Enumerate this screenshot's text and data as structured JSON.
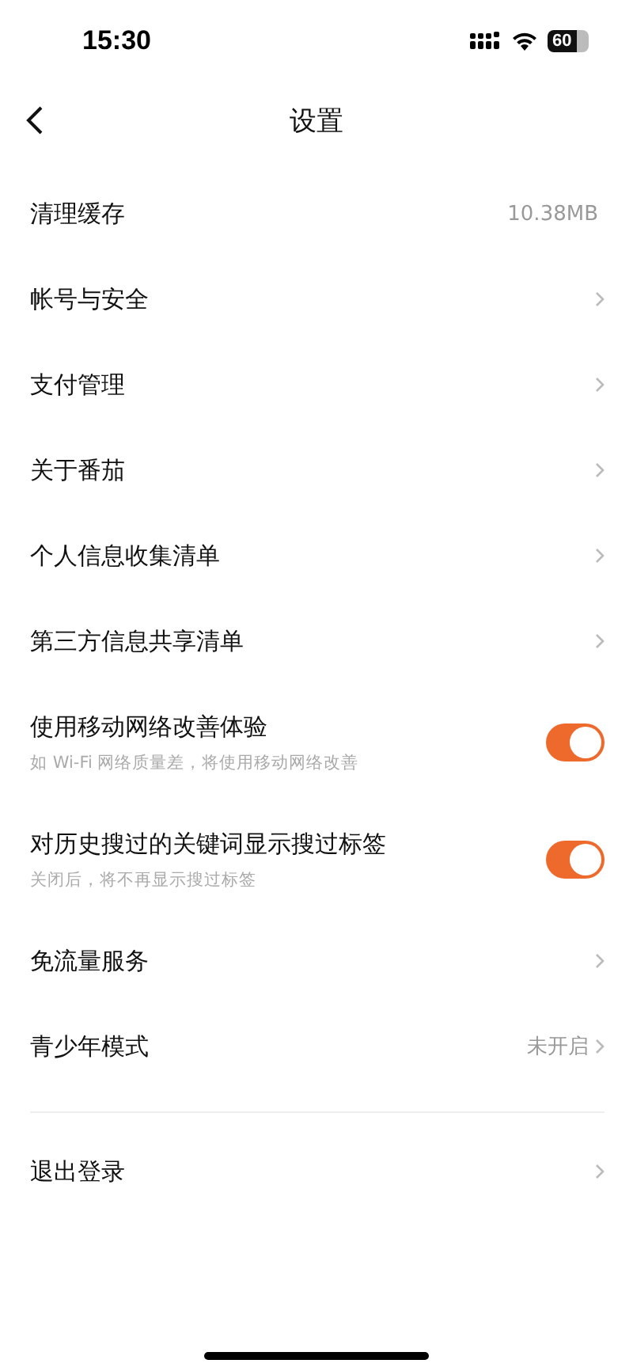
{
  "status_bar": {
    "time": "15:30",
    "battery": "60"
  },
  "nav": {
    "title": "设置"
  },
  "items": [
    {
      "kind": "value",
      "label": "清理缓存",
      "value": "10.38MB"
    },
    {
      "kind": "link",
      "label": "帐号与安全"
    },
    {
      "kind": "link",
      "label": "支付管理"
    },
    {
      "kind": "link",
      "label": "关于番茄"
    },
    {
      "kind": "link",
      "label": "个人信息收集清单"
    },
    {
      "kind": "link",
      "label": "第三方信息共享清单"
    },
    {
      "kind": "toggle",
      "label": "使用移动网络改善体验",
      "subtitle": "如 Wi-Fi 网络质量差，将使用移动网络改善",
      "on": true
    },
    {
      "kind": "toggle",
      "label": "对历史搜过的关键词显示搜过标签",
      "subtitle": "关闭后，将不再显示搜过标签",
      "on": true
    },
    {
      "kind": "link",
      "label": "免流量服务"
    },
    {
      "kind": "link",
      "label": "青少年模式",
      "value": "未开启"
    }
  ],
  "logout": {
    "label": "退出登录"
  }
}
